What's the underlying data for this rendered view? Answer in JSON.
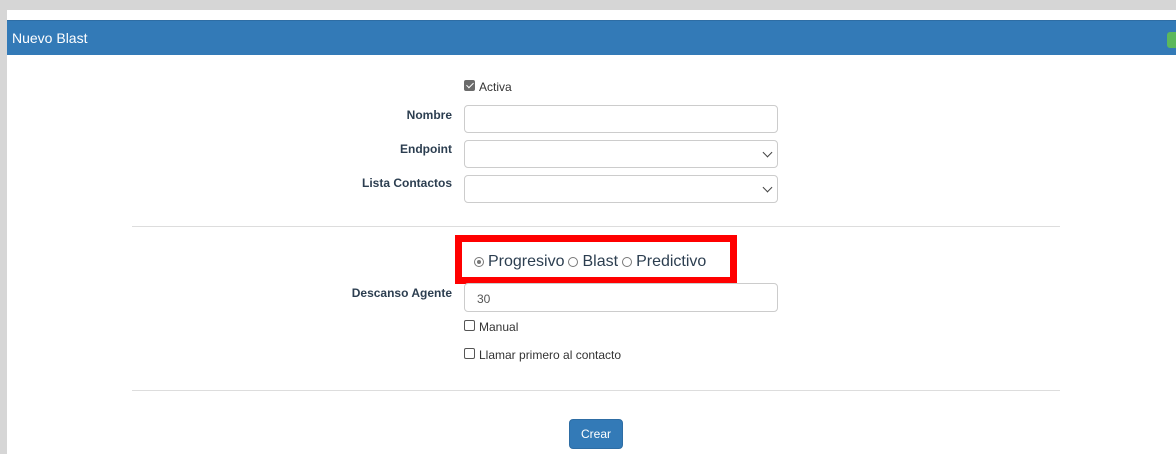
{
  "panel": {
    "title": "Nuevo Blast"
  },
  "form": {
    "activa_label": "Activa",
    "activa_checked": true,
    "nombre_label": "Nombre",
    "nombre_value": "",
    "endpoint_label": "Endpoint",
    "endpoint_value": "",
    "lista_label": "Lista Contactos",
    "lista_value": "",
    "mode_options": [
      "Progresivo",
      "Blast",
      "Predictivo"
    ],
    "mode_selected": "Progresivo",
    "descanso_label": "Descanso Agente",
    "descanso_value": "30",
    "manual_label": "Manual",
    "manual_checked": false,
    "llamar_label": "Llamar primero al contacto",
    "llamar_checked": false,
    "create_label": "Crear"
  },
  "colors": {
    "header_bg": "#337ab7",
    "highlight_border": "#ff0000",
    "corner_button": "#5cb85c"
  }
}
